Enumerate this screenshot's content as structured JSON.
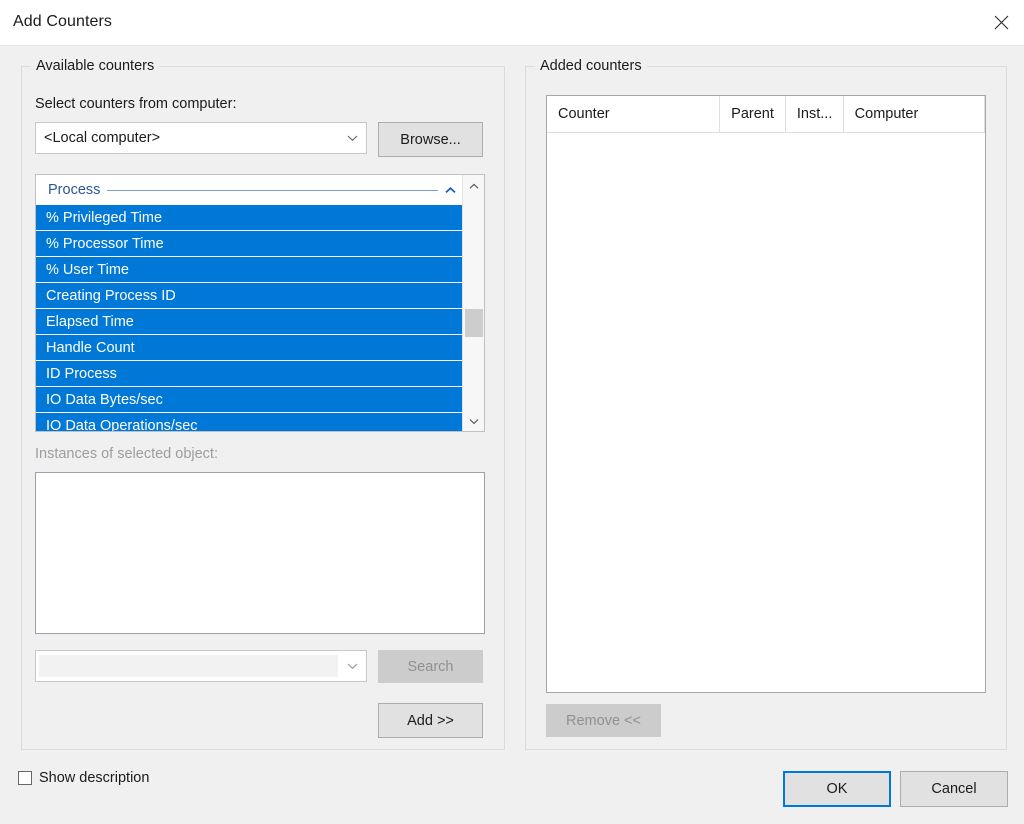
{
  "window": {
    "title": "Add Counters",
    "close_icon": "close-icon"
  },
  "available": {
    "legend": "Available counters",
    "select_computer_label": "Select counters from computer:",
    "computer_combo": {
      "value": "<Local computer>",
      "arrow_icon": "chevron-down-icon"
    },
    "browse_button": "Browse...",
    "tree": {
      "category": "Process",
      "collapse_icon": "chevron-up-icon",
      "counters": [
        "% Privileged Time",
        "% Processor Time",
        "% User Time",
        "Creating Process ID",
        "Elapsed Time",
        "Handle Count",
        "ID Process",
        "IO Data Bytes/sec",
        "IO Data Operations/sec"
      ],
      "scrollbar": {
        "up_icon": "chevron-up-icon",
        "down_icon": "chevron-down-icon"
      }
    },
    "instances_label": "Instances of selected object:",
    "instances": [],
    "search_combo": {
      "value": "",
      "placeholder": "",
      "arrow_icon": "chevron-down-icon"
    },
    "search_button": "Search",
    "add_button": "Add >>"
  },
  "added": {
    "legend": "Added counters",
    "columns": [
      "Counter",
      "Parent",
      "Inst...",
      "Computer"
    ],
    "rows": [],
    "remove_button": "Remove <<"
  },
  "footer": {
    "show_description_label": "Show description",
    "show_description_checked": false,
    "ok_button": "OK",
    "cancel_button": "Cancel"
  },
  "colors": {
    "selection": "#0078d7",
    "accent": "#0078d7",
    "category_text": "#2b579a",
    "dialog_bg": "#f0f0f0",
    "disabled_text": "#909090"
  }
}
